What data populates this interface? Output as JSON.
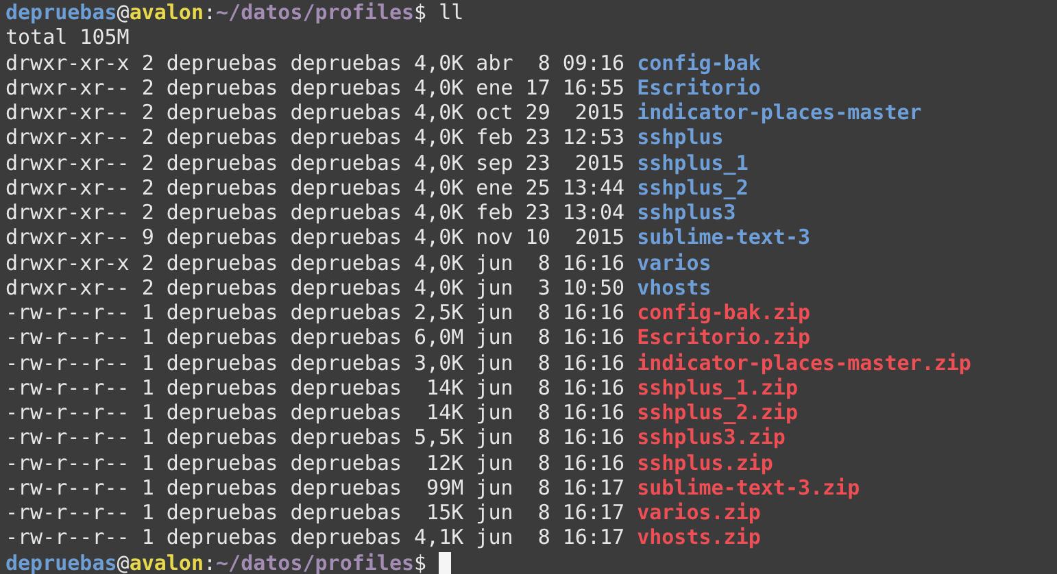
{
  "terminal": {
    "lines": [
      {
        "kind": "prompt",
        "user": "depruebas",
        "at": "@",
        "host": "avalon",
        "separator": ":",
        "path": "~/datos/profiles",
        "symbol": "$",
        "command": "ll",
        "cursor": false
      },
      {
        "kind": "output",
        "text": "total 105M"
      },
      {
        "kind": "entry",
        "info": "drwxr-xr-x 2 depruebas depruebas 4,0K abr  8 09:16",
        "name": "config-bak",
        "color": "#6f9fd9"
      },
      {
        "kind": "entry",
        "info": "drwxr-xr-- 2 depruebas depruebas 4,0K ene 17 16:55",
        "name": "Escritorio",
        "color": "#6f9fd9"
      },
      {
        "kind": "entry",
        "info": "drwxr-xr-- 2 depruebas depruebas 4,0K oct 29  2015",
        "name": "indicator-places-master",
        "color": "#6f9fd9"
      },
      {
        "kind": "entry",
        "info": "drwxr-xr-- 2 depruebas depruebas 4,0K feb 23 12:53",
        "name": "sshplus",
        "color": "#6f9fd9"
      },
      {
        "kind": "entry",
        "info": "drwxr-xr-- 2 depruebas depruebas 4,0K sep 23  2015",
        "name": "sshplus_1",
        "color": "#6f9fd9"
      },
      {
        "kind": "entry",
        "info": "drwxr-xr-- 2 depruebas depruebas 4,0K ene 25 13:44",
        "name": "sshplus_2",
        "color": "#6f9fd9"
      },
      {
        "kind": "entry",
        "info": "drwxr-xr-- 2 depruebas depruebas 4,0K feb 23 13:04",
        "name": "sshplus3",
        "color": "#6f9fd9"
      },
      {
        "kind": "entry",
        "info": "drwxr-xr-- 9 depruebas depruebas 4,0K nov 10  2015",
        "name": "sublime-text-3",
        "color": "#6f9fd9"
      },
      {
        "kind": "entry",
        "info": "drwxr-xr-x 2 depruebas depruebas 4,0K jun  8 16:16",
        "name": "varios",
        "color": "#6f9fd9"
      },
      {
        "kind": "entry",
        "info": "drwxr-xr-- 2 depruebas depruebas 4,0K jun  3 10:50",
        "name": "vhosts",
        "color": "#6f9fd9"
      },
      {
        "kind": "entry",
        "info": "-rw-r--r-- 1 depruebas depruebas 2,5K jun  8 16:16",
        "name": "config-bak.zip",
        "color": "#ee4f55"
      },
      {
        "kind": "entry",
        "info": "-rw-r--r-- 1 depruebas depruebas 6,0M jun  8 16:16",
        "name": "Escritorio.zip",
        "color": "#ee4f55"
      },
      {
        "kind": "entry",
        "info": "-rw-r--r-- 1 depruebas depruebas 3,0K jun  8 16:16",
        "name": "indicator-places-master.zip",
        "color": "#ee4f55"
      },
      {
        "kind": "entry",
        "info": "-rw-r--r-- 1 depruebas depruebas  14K jun  8 16:16",
        "name": "sshplus_1.zip",
        "color": "#ee4f55"
      },
      {
        "kind": "entry",
        "info": "-rw-r--r-- 1 depruebas depruebas  14K jun  8 16:16",
        "name": "sshplus_2.zip",
        "color": "#ee4f55"
      },
      {
        "kind": "entry",
        "info": "-rw-r--r-- 1 depruebas depruebas 5,5K jun  8 16:16",
        "name": "sshplus3.zip",
        "color": "#ee4f55"
      },
      {
        "kind": "entry",
        "info": "-rw-r--r-- 1 depruebas depruebas  12K jun  8 16:16",
        "name": "sshplus.zip",
        "color": "#ee4f55"
      },
      {
        "kind": "entry",
        "info": "-rw-r--r-- 1 depruebas depruebas  99M jun  8 16:17",
        "name": "sublime-text-3.zip",
        "color": "#ee4f55"
      },
      {
        "kind": "entry",
        "info": "-rw-r--r-- 1 depruebas depruebas  15K jun  8 16:17",
        "name": "varios.zip",
        "color": "#ee4f55"
      },
      {
        "kind": "entry",
        "info": "-rw-r--r-- 1 depruebas depruebas 4,1K jun  8 16:17",
        "name": "vhosts.zip",
        "color": "#ee4f55"
      },
      {
        "kind": "prompt",
        "user": "depruebas",
        "at": "@",
        "host": "avalon",
        "separator": ":",
        "path": "~/datos/profiles",
        "symbol": "$",
        "cursor": true
      }
    ]
  }
}
